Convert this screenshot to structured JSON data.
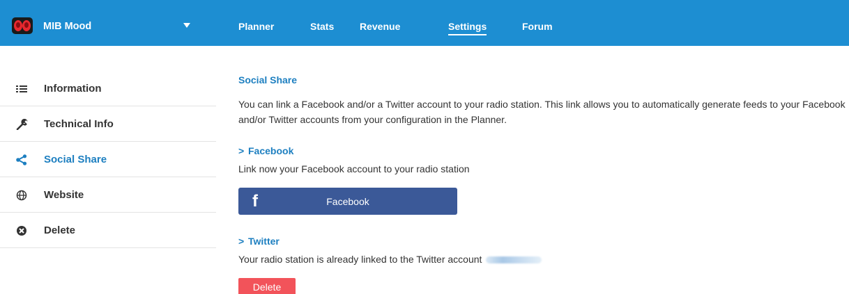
{
  "header": {
    "station_name": "MIB Mood",
    "nav": [
      {
        "label": "Planner"
      },
      {
        "label": "Stats"
      },
      {
        "label": "Revenue"
      },
      {
        "label": "Settings",
        "active": true
      },
      {
        "label": "Forum"
      }
    ]
  },
  "sidebar": {
    "items": [
      {
        "label": "Information",
        "icon": "list-icon"
      },
      {
        "label": "Technical Info",
        "icon": "wrench-icon"
      },
      {
        "label": "Social Share",
        "icon": "share-icon",
        "active": true
      },
      {
        "label": "Website",
        "icon": "globe-icon"
      },
      {
        "label": "Delete",
        "icon": "delete-circle-icon"
      }
    ]
  },
  "main": {
    "title": "Social Share",
    "description": "You can link a Facebook and/or a Twitter account to your radio station. This link allows you to automatically generate feeds to your Facebook and/or Twitter accounts from your configuration in the Planner.",
    "facebook": {
      "heading": "Facebook",
      "text": "Link now your Facebook account to your radio station",
      "button_icon": "f",
      "button_label": "Facebook"
    },
    "twitter": {
      "heading": "Twitter",
      "text": "Your radio station is already linked to the Twitter account",
      "delete_label": "Delete"
    }
  },
  "colors": {
    "topbar": "#1d8ed2",
    "accent": "#1d7fc0",
    "facebook": "#3b5998",
    "delete": "#f2535a"
  }
}
